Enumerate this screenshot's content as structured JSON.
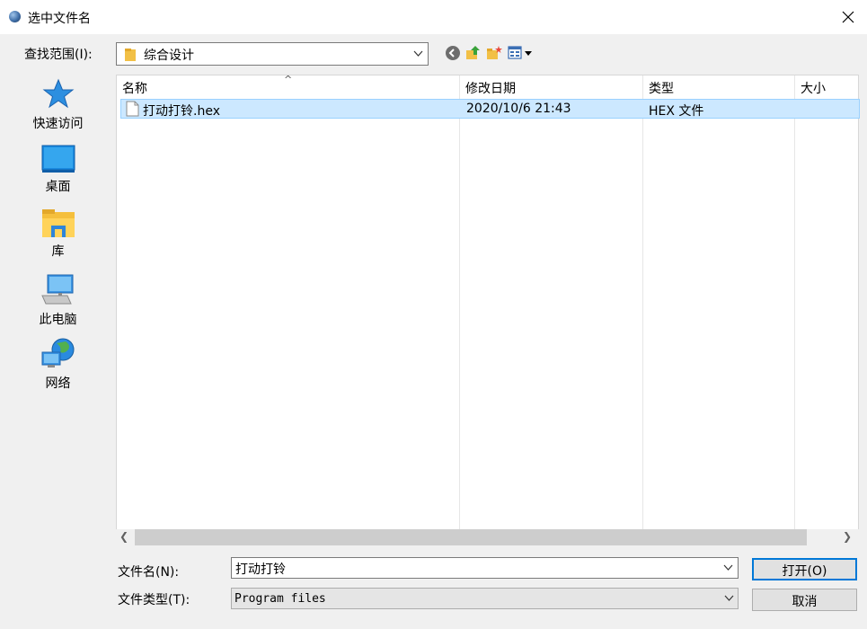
{
  "window": {
    "title": "选中文件名"
  },
  "lookin": {
    "label": "查找范围(I):",
    "value": "综合设计"
  },
  "places": [
    {
      "label": "快速访问",
      "icon": "star-icon"
    },
    {
      "label": "桌面",
      "icon": "desktop-icon"
    },
    {
      "label": "库",
      "icon": "library-icon"
    },
    {
      "label": "此电脑",
      "icon": "computer-icon"
    },
    {
      "label": "网络",
      "icon": "network-icon"
    }
  ],
  "filelist": {
    "columns": [
      "名称",
      "修改日期",
      "类型",
      "大小"
    ],
    "rows": [
      {
        "name": "打动打铃.hex",
        "modified": "2020/10/6 21:43",
        "type": "HEX 文件",
        "size": ""
      }
    ]
  },
  "bottom": {
    "filename_label": "文件名(N):",
    "filename_value": "打动打铃",
    "filetype_label": "文件类型(T):",
    "filetype_value": "Program files",
    "open_label": "打开(O)",
    "cancel_label": "取消"
  },
  "colors": {
    "selection": "#cce8ff",
    "selection_border": "#99d1ff",
    "accent": "#0078d7"
  }
}
